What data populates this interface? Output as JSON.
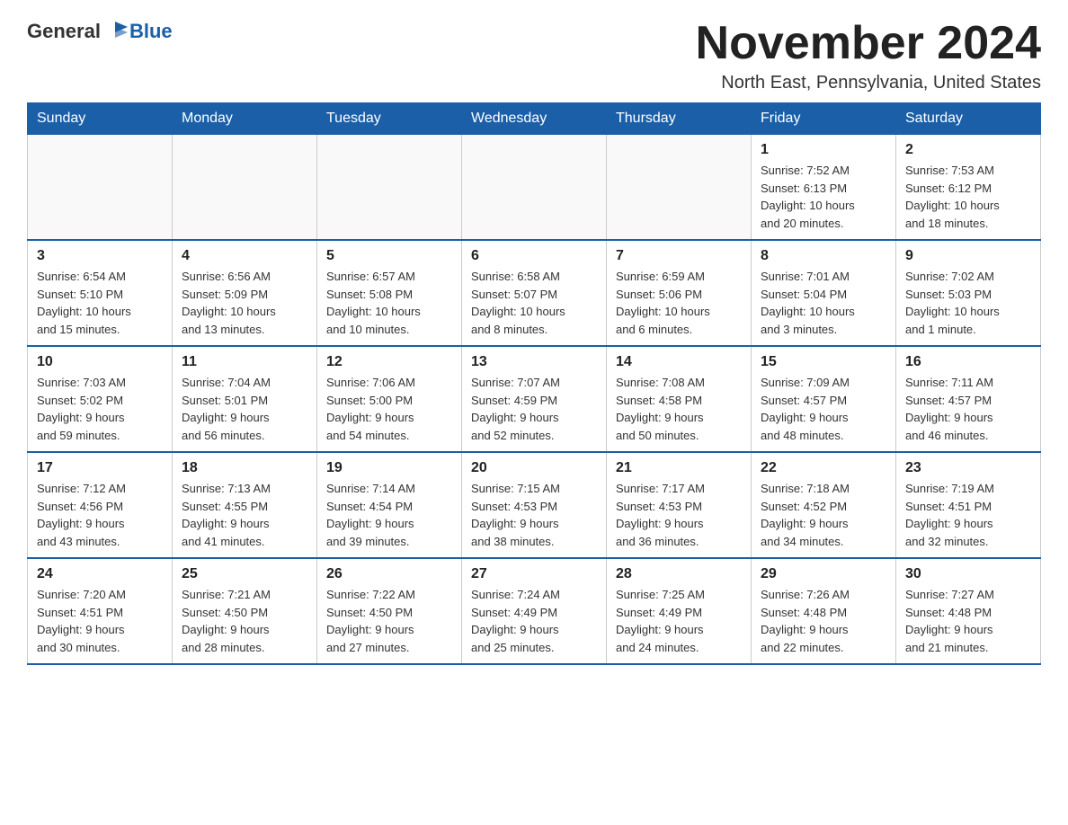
{
  "logo": {
    "text_general": "General",
    "text_blue": "Blue"
  },
  "title": "November 2024",
  "location": "North East, Pennsylvania, United States",
  "headers": [
    "Sunday",
    "Monday",
    "Tuesday",
    "Wednesday",
    "Thursday",
    "Friday",
    "Saturday"
  ],
  "weeks": [
    [
      {
        "day": "",
        "info": ""
      },
      {
        "day": "",
        "info": ""
      },
      {
        "day": "",
        "info": ""
      },
      {
        "day": "",
        "info": ""
      },
      {
        "day": "",
        "info": ""
      },
      {
        "day": "1",
        "info": "Sunrise: 7:52 AM\nSunset: 6:13 PM\nDaylight: 10 hours\nand 20 minutes."
      },
      {
        "day": "2",
        "info": "Sunrise: 7:53 AM\nSunset: 6:12 PM\nDaylight: 10 hours\nand 18 minutes."
      }
    ],
    [
      {
        "day": "3",
        "info": "Sunrise: 6:54 AM\nSunset: 5:10 PM\nDaylight: 10 hours\nand 15 minutes."
      },
      {
        "day": "4",
        "info": "Sunrise: 6:56 AM\nSunset: 5:09 PM\nDaylight: 10 hours\nand 13 minutes."
      },
      {
        "day": "5",
        "info": "Sunrise: 6:57 AM\nSunset: 5:08 PM\nDaylight: 10 hours\nand 10 minutes."
      },
      {
        "day": "6",
        "info": "Sunrise: 6:58 AM\nSunset: 5:07 PM\nDaylight: 10 hours\nand 8 minutes."
      },
      {
        "day": "7",
        "info": "Sunrise: 6:59 AM\nSunset: 5:06 PM\nDaylight: 10 hours\nand 6 minutes."
      },
      {
        "day": "8",
        "info": "Sunrise: 7:01 AM\nSunset: 5:04 PM\nDaylight: 10 hours\nand 3 minutes."
      },
      {
        "day": "9",
        "info": "Sunrise: 7:02 AM\nSunset: 5:03 PM\nDaylight: 10 hours\nand 1 minute."
      }
    ],
    [
      {
        "day": "10",
        "info": "Sunrise: 7:03 AM\nSunset: 5:02 PM\nDaylight: 9 hours\nand 59 minutes."
      },
      {
        "day": "11",
        "info": "Sunrise: 7:04 AM\nSunset: 5:01 PM\nDaylight: 9 hours\nand 56 minutes."
      },
      {
        "day": "12",
        "info": "Sunrise: 7:06 AM\nSunset: 5:00 PM\nDaylight: 9 hours\nand 54 minutes."
      },
      {
        "day": "13",
        "info": "Sunrise: 7:07 AM\nSunset: 4:59 PM\nDaylight: 9 hours\nand 52 minutes."
      },
      {
        "day": "14",
        "info": "Sunrise: 7:08 AM\nSunset: 4:58 PM\nDaylight: 9 hours\nand 50 minutes."
      },
      {
        "day": "15",
        "info": "Sunrise: 7:09 AM\nSunset: 4:57 PM\nDaylight: 9 hours\nand 48 minutes."
      },
      {
        "day": "16",
        "info": "Sunrise: 7:11 AM\nSunset: 4:57 PM\nDaylight: 9 hours\nand 46 minutes."
      }
    ],
    [
      {
        "day": "17",
        "info": "Sunrise: 7:12 AM\nSunset: 4:56 PM\nDaylight: 9 hours\nand 43 minutes."
      },
      {
        "day": "18",
        "info": "Sunrise: 7:13 AM\nSunset: 4:55 PM\nDaylight: 9 hours\nand 41 minutes."
      },
      {
        "day": "19",
        "info": "Sunrise: 7:14 AM\nSunset: 4:54 PM\nDaylight: 9 hours\nand 39 minutes."
      },
      {
        "day": "20",
        "info": "Sunrise: 7:15 AM\nSunset: 4:53 PM\nDaylight: 9 hours\nand 38 minutes."
      },
      {
        "day": "21",
        "info": "Sunrise: 7:17 AM\nSunset: 4:53 PM\nDaylight: 9 hours\nand 36 minutes."
      },
      {
        "day": "22",
        "info": "Sunrise: 7:18 AM\nSunset: 4:52 PM\nDaylight: 9 hours\nand 34 minutes."
      },
      {
        "day": "23",
        "info": "Sunrise: 7:19 AM\nSunset: 4:51 PM\nDaylight: 9 hours\nand 32 minutes."
      }
    ],
    [
      {
        "day": "24",
        "info": "Sunrise: 7:20 AM\nSunset: 4:51 PM\nDaylight: 9 hours\nand 30 minutes."
      },
      {
        "day": "25",
        "info": "Sunrise: 7:21 AM\nSunset: 4:50 PM\nDaylight: 9 hours\nand 28 minutes."
      },
      {
        "day": "26",
        "info": "Sunrise: 7:22 AM\nSunset: 4:50 PM\nDaylight: 9 hours\nand 27 minutes."
      },
      {
        "day": "27",
        "info": "Sunrise: 7:24 AM\nSunset: 4:49 PM\nDaylight: 9 hours\nand 25 minutes."
      },
      {
        "day": "28",
        "info": "Sunrise: 7:25 AM\nSunset: 4:49 PM\nDaylight: 9 hours\nand 24 minutes."
      },
      {
        "day": "29",
        "info": "Sunrise: 7:26 AM\nSunset: 4:48 PM\nDaylight: 9 hours\nand 22 minutes."
      },
      {
        "day": "30",
        "info": "Sunrise: 7:27 AM\nSunset: 4:48 PM\nDaylight: 9 hours\nand 21 minutes."
      }
    ]
  ]
}
